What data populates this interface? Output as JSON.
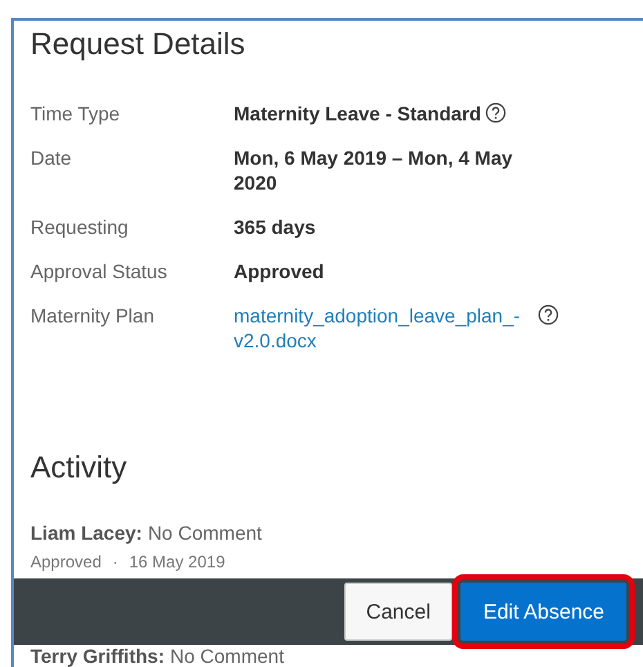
{
  "title": "Request Details",
  "fields": [
    {
      "label": "Time Type",
      "value": "Maternity Leave - Standard",
      "kind": "text",
      "help": true
    },
    {
      "label": "Date",
      "value": "Mon, 6 May 2019 – Mon, 4 May 2020",
      "kind": "text",
      "help": false
    },
    {
      "label": "Requesting",
      "value": "365 days",
      "kind": "text",
      "help": false
    },
    {
      "label": "Approval Status",
      "value": "Approved",
      "kind": "text",
      "help": false
    },
    {
      "label": "Maternity Plan",
      "value": "maternity_adoption_leave_plan_- v2.0.docx",
      "kind": "link",
      "help": true
    }
  ],
  "activity": {
    "title": "Activity",
    "entries": [
      {
        "name": "Liam Lacey:",
        "comment": "No Comment",
        "status": "Approved",
        "separator": "·",
        "date": "16 May 2019"
      },
      {
        "name": "Terry Griffiths:",
        "comment": "No Comment"
      }
    ]
  },
  "buttons": [
    {
      "label": "Cancel",
      "primary": false,
      "highlighted": false
    },
    {
      "label": "Edit Absence",
      "primary": true,
      "highlighted": true
    }
  ]
}
